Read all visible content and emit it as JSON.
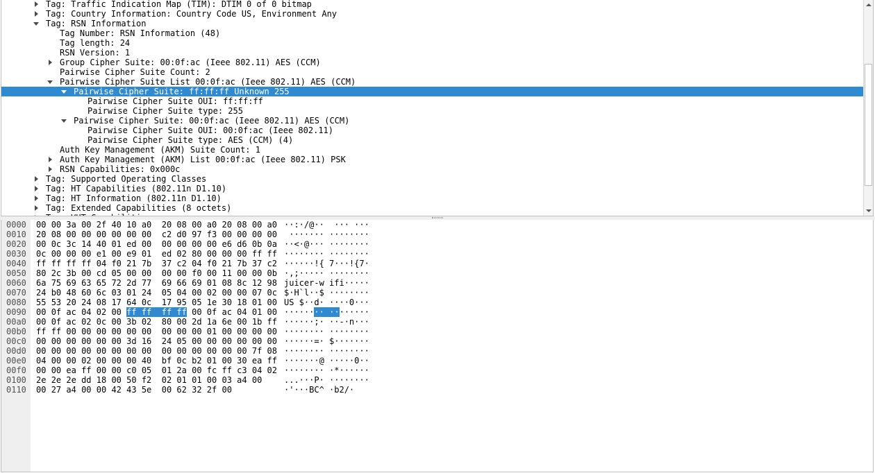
{
  "tree": {
    "rows": [
      {
        "text": "Tag: Traffic Indication Map (TIM): DTIM 0 of 0 bitmap",
        "depth": 1,
        "arrow": "right",
        "selected": false
      },
      {
        "text": "Tag: Country Information: Country Code US, Environment Any",
        "depth": 1,
        "arrow": "right",
        "selected": false
      },
      {
        "text": "Tag: RSN Information",
        "depth": 1,
        "arrow": "down",
        "selected": false
      },
      {
        "text": "Tag Number: RSN Information (48)",
        "depth": 2,
        "arrow": "none",
        "selected": false
      },
      {
        "text": "Tag length: 24",
        "depth": 2,
        "arrow": "none",
        "selected": false
      },
      {
        "text": "RSN Version: 1",
        "depth": 2,
        "arrow": "none",
        "selected": false
      },
      {
        "text": "Group Cipher Suite: 00:0f:ac (Ieee 802.11) AES (CCM)",
        "depth": 2,
        "arrow": "right",
        "selected": false
      },
      {
        "text": "Pairwise Cipher Suite Count: 2",
        "depth": 2,
        "arrow": "none",
        "selected": false
      },
      {
        "text": "Pairwise Cipher Suite List 00:0f:ac (Ieee 802.11) AES (CCM)",
        "depth": 2,
        "arrow": "down",
        "selected": false
      },
      {
        "text": "Pairwise Cipher Suite: ff:ff:ff Unknown 255",
        "depth": 3,
        "arrow": "down",
        "selected": true
      },
      {
        "text": "Pairwise Cipher Suite OUI: ff:ff:ff",
        "depth": 4,
        "arrow": "none",
        "selected": false
      },
      {
        "text": "Pairwise Cipher Suite type: 255",
        "depth": 4,
        "arrow": "none",
        "selected": false
      },
      {
        "text": "Pairwise Cipher Suite: 00:0f:ac (Ieee 802.11) AES (CCM)",
        "depth": 3,
        "arrow": "down",
        "selected": false
      },
      {
        "text": "Pairwise Cipher Suite OUI: 00:0f:ac (Ieee 802.11)",
        "depth": 4,
        "arrow": "none",
        "selected": false
      },
      {
        "text": "Pairwise Cipher Suite type: AES (CCM) (4)",
        "depth": 4,
        "arrow": "none",
        "selected": false
      },
      {
        "text": "Auth Key Management (AKM) Suite Count: 1",
        "depth": 2,
        "arrow": "none",
        "selected": false
      },
      {
        "text": "Auth Key Management (AKM) List 00:0f:ac (Ieee 802.11) PSK",
        "depth": 2,
        "arrow": "right",
        "selected": false
      },
      {
        "text": "RSN Capabilities: 0x000c",
        "depth": 2,
        "arrow": "right",
        "selected": false
      },
      {
        "text": "Tag: Supported Operating Classes",
        "depth": 1,
        "arrow": "right",
        "selected": false
      },
      {
        "text": "Tag: HT Capabilities (802.11n D1.10)",
        "depth": 1,
        "arrow": "right",
        "selected": false
      },
      {
        "text": "Tag: HT Information (802.11n D1.10)",
        "depth": 1,
        "arrow": "right",
        "selected": false
      },
      {
        "text": "Tag: Extended Capabilities (8 octets)",
        "depth": 1,
        "arrow": "right",
        "selected": false
      },
      {
        "text": "Tag: VHT Capabilities",
        "depth": 1,
        "arrow": "right",
        "selected": false
      }
    ]
  },
  "bytes": {
    "highlight": {
      "row": 9,
      "hex_start": 6,
      "hex_end": 9
    },
    "rows": [
      {
        "offset": "0000",
        "hex": "00 00 3a 00 2f 40 10 a0  20 08 00 a0 20 08 00 a0",
        "ascii": "··:·/@··  ··· ···"
      },
      {
        "offset": "0010",
        "hex": "20 08 00 00 00 00 00 00  c2 d0 97 f3 00 00 00 00",
        "ascii": " ······· ········"
      },
      {
        "offset": "0020",
        "hex": "00 0c 3c 14 40 01 ed 00  00 00 00 00 e6 d6 0b 0a",
        "ascii": "··<·@··· ········"
      },
      {
        "offset": "0030",
        "hex": "0c 00 00 00 e1 00 e9 01  ed 02 80 00 00 00 ff ff",
        "ascii": "········ ········"
      },
      {
        "offset": "0040",
        "hex": "ff ff ff ff 04 f0 21 7b  37 c2 04 f0 21 7b 37 c2",
        "ascii": "······!{ 7···!{7·"
      },
      {
        "offset": "0050",
        "hex": "80 2c 3b 00 cd 05 00 00  00 00 f0 00 11 00 00 0b",
        "ascii": "·,;····· ········"
      },
      {
        "offset": "0060",
        "hex": "6a 75 69 63 65 72 2d 77  69 66 69 01 08 8c 12 98",
        "ascii": "juicer-w ifi·····"
      },
      {
        "offset": "0070",
        "hex": "24 b0 48 60 6c 03 01 24  05 04 00 02 00 00 07 0c",
        "ascii": "$·H`l··$ ········"
      },
      {
        "offset": "0080",
        "hex": "55 53 20 24 08 17 64 0c  17 95 05 1e 30 18 01 00",
        "ascii": "US $··d· ····0···"
      },
      {
        "offset": "0090",
        "hex": "00 0f ac 04 02 00 ff ff  ff ff 00 0f ac 04 01 00",
        "ascii": "········ ········"
      },
      {
        "offset": "00a0",
        "hex": "00 0f ac 02 0c 00 3b 02  80 00 2d 1a 6e 00 1b ff",
        "ascii": "······;· ··-·n···"
      },
      {
        "offset": "00b0",
        "hex": "ff ff 00 00 00 00 00 00  00 00 00 01 00 00 00 00",
        "ascii": "········ ········"
      },
      {
        "offset": "00c0",
        "hex": "00 00 00 00 00 00 3d 16  24 05 00 00 00 00 00 00",
        "ascii": "······=· $·······"
      },
      {
        "offset": "00d0",
        "hex": "00 00 00 00 00 00 00 00  00 00 00 00 00 00 7f 08",
        "ascii": "········ ········"
      },
      {
        "offset": "00e0",
        "hex": "04 00 00 02 00 00 00 40  bf 0c b2 01 00 30 ea ff",
        "ascii": "·······@ ·····0··"
      },
      {
        "offset": "00f0",
        "hex": "00 00 ea ff 00 00 c0 05  01 2a 00 fc ff c3 04 02",
        "ascii": "········ ·*······"
      },
      {
        "offset": "0100",
        "hex": "2e 2e 2e dd 18 00 50 f2  02 01 01 00 03 a4 00",
        "ascii": "...···P· ········"
      },
      {
        "offset": "0110",
        "hex": "00 27 a4 00 00 42 43 5e  00 62 32 2f 00",
        "ascii": "·'···BC^ ·b2/·"
      }
    ]
  }
}
